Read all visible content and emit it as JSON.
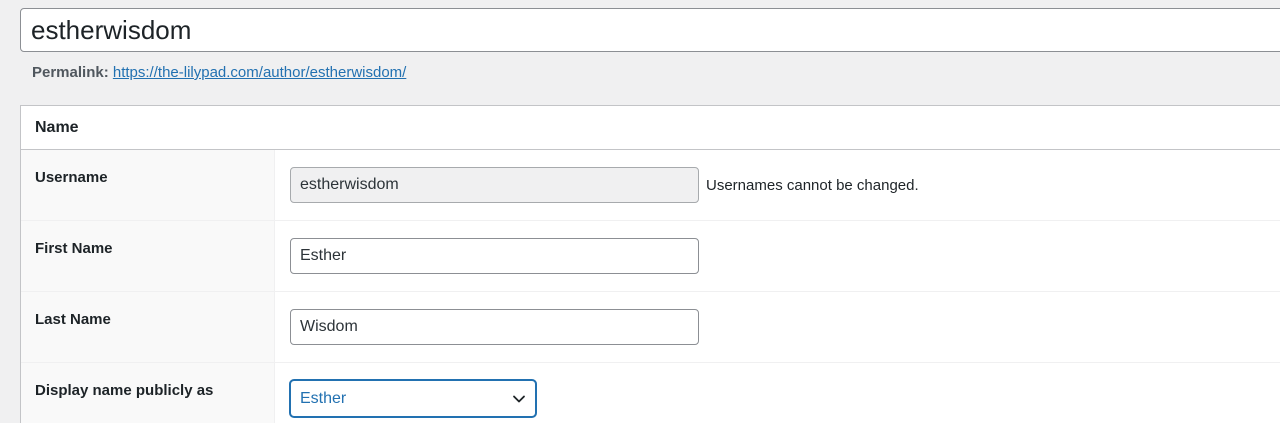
{
  "post": {
    "title": "estherwisdom",
    "permalink_label": "Permalink:",
    "permalink_url": "https://the-lilypad.com/author/estherwisdom/"
  },
  "name_section": {
    "heading": "Name",
    "username": {
      "label": "Username",
      "value": "estherwisdom",
      "hint": "Usernames cannot be changed."
    },
    "first_name": {
      "label": "First Name",
      "value": "Esther"
    },
    "last_name": {
      "label": "Last Name",
      "value": "Wisdom"
    },
    "display_name": {
      "label": "Display name publicly as",
      "selected": "Esther"
    }
  },
  "icons": {
    "display_name_dropdown": "chevron-down-icon"
  },
  "colors": {
    "link": "#2271b1",
    "focus": "#2271b1",
    "background": "#f0f0f1"
  }
}
